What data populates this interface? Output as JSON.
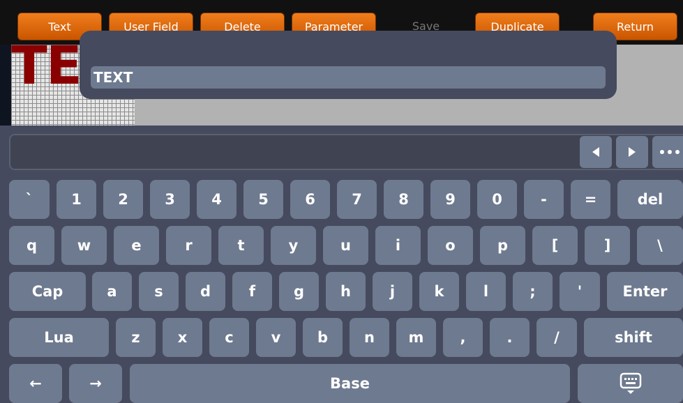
{
  "toolbar": {
    "text_label": "Text",
    "user_field_label": "User Field",
    "delete_label": "Delete",
    "parameter_label": "Parameter",
    "save_label": "Save",
    "duplicate_label": "Duplicate",
    "return_label": "Return"
  },
  "editor": {
    "preview_text": "TEX"
  },
  "popup": {
    "input_value": "TEXT"
  },
  "keyboard": {
    "row1": [
      "`",
      "1",
      "2",
      "3",
      "4",
      "5",
      "6",
      "7",
      "8",
      "9",
      "0",
      "-",
      "=",
      "del"
    ],
    "row2": [
      "q",
      "w",
      "e",
      "r",
      "t",
      "y",
      "u",
      "i",
      "o",
      "p",
      "[",
      "]",
      "\\"
    ],
    "row3": [
      "Cap",
      "a",
      "s",
      "d",
      "f",
      "g",
      "h",
      "j",
      "k",
      "l",
      ";",
      "'",
      "Enter"
    ],
    "row4": [
      "Lua",
      "z",
      "x",
      "c",
      "v",
      "b",
      "n",
      "m",
      ",",
      ".",
      "/",
      "shift"
    ],
    "row5": {
      "left": "←",
      "right": "→",
      "space": "Base"
    }
  },
  "colors": {
    "toolbar_button": "#e06c10",
    "keyboard_bg": "#454a5e",
    "key_bg": "#6e7a8f",
    "preview_text": "#8a0000"
  },
  "icons": [
    "caret-left-icon",
    "caret-right-icon",
    "more-icon",
    "keyboard-hide-icon"
  ]
}
